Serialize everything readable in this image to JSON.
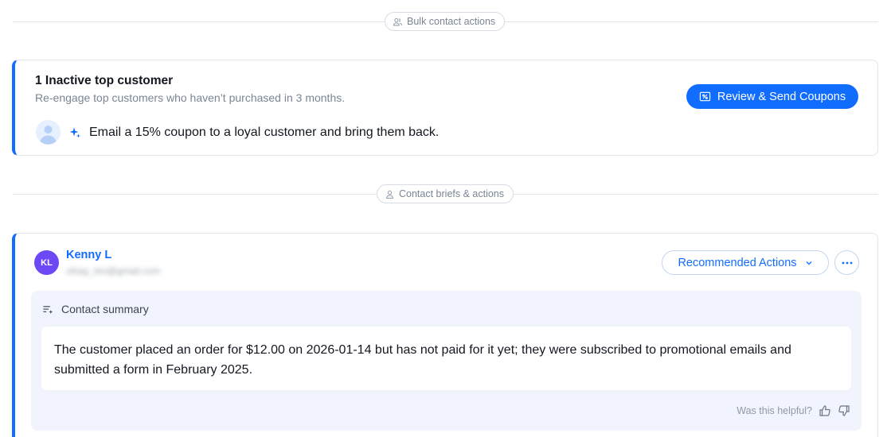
{
  "sections": {
    "bulk_label": "Bulk contact actions",
    "briefs_label": "Contact briefs & actions"
  },
  "inactive_card": {
    "title": "1 Inactive top customer",
    "subtitle": "Re-engage top customers who haven’t purchased in 3 months.",
    "primary_button": "Review & Send Coupons",
    "suggestion": "Email a 15% coupon to a loyal customer and bring them back."
  },
  "contact_card": {
    "initials": "KL",
    "name": "Kenny L",
    "email": "ufsay_leo@gmail.com",
    "recommended_actions_label": "Recommended Actions",
    "summary_title": "Contact summary",
    "summary_text": "The customer placed an order for $12.00 on 2026-01-14 but has not paid for it yet; they were subscribed to promotional emails and submitted a form in February 2025.",
    "helpful_prompt": "Was this helpful?"
  },
  "icons": [
    "users-icon",
    "user-icon",
    "coupon-icon",
    "avatar-placeholder-icon",
    "sparkle-icon",
    "chevron-down-icon",
    "more-horizontal-icon",
    "ai-list-icon",
    "thumbs-up-icon",
    "thumbs-down-icon"
  ],
  "colors": {
    "accent": "#116dff",
    "avatar_purple": "#6d48f5",
    "summary_bg": "#f1f4fd"
  }
}
